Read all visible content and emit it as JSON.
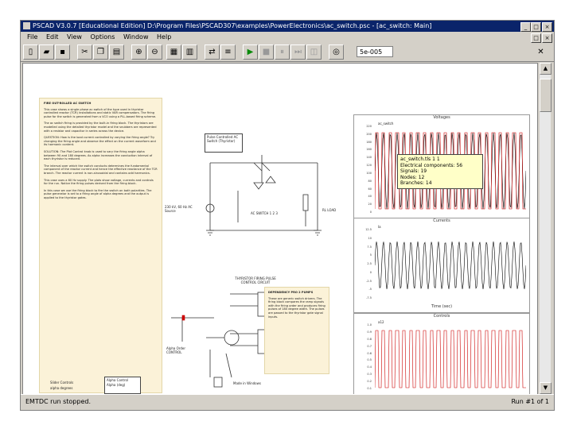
{
  "window": {
    "title": "PSCAD V3.0.7 [Educational Edition] D:\\Program Files\\PSCAD307\\examples\\PowerElectronics\\ac_switch.psc - [ac_switch: Main]"
  },
  "menu": [
    "File",
    "Edit",
    "View",
    "Options",
    "Window",
    "Help"
  ],
  "toolbar": {
    "runs_value": "5e-005"
  },
  "note_main": {
    "title": "FIRE OUT-ROLLED AC SWITCH",
    "paragraphs": [
      "This case shows a single phase ac switch of the type used in thyristor controlled reactor (TCR) installations and static VAR compensators. The firing pulse for the switch is generated from a VCO using a PLL-based firing scheme.",
      "The ac switch firing is provided by the built-in firing block. The thyristors are modelled using the detailed thyristor model and the snubbers are represented with a resistor and capacitor in series across the device.",
      "QUESTION: How is the load current controlled by varying the firing angle? Try changing the firing angle and observe the effect on the current waveform and its harmonic content.",
      "SOLUTION: The Plot Control knob is used to vary the firing angle alpha between 90 and 180 degrees. As alpha increases the conduction interval of each thyristor is reduced.",
      "The interval over which the switch conducts determines the fundamental component of the reactor current and hence the effective reactance of the TCR branch. The reactor current is non-sinusoidal and contains odd harmonics.",
      "This case uses a 60 Hz supply. The plots show voltage, currents and controls for the run. Notice the firing pulses derived from the firing block.",
      "In this case we use the firing block to fire the switch on both polarities. The pulse generator is set to a firing angle of alpha degrees and the output is applied to the thyristor gates."
    ]
  },
  "note_thyristor": {
    "text": "These are generic switch drivers. The firing block compares the ramp signals with the firing order and produces firing pulses of 180 degree width. The pulses are passed to the thyristor gate signal inputs."
  },
  "circuit_labels": {
    "pulse_controlled": "Pulse Controlled AC Switch (Thyristor)",
    "source": "230 kV, 60 Hz AC Source",
    "rectifier": "AC SWITCH 1 2 3",
    "load": "RL LOAD",
    "firing_title": "THYRISTOR FIRING PULSE CONTROL CIRCUIT",
    "dependency": "DEPENDENCY PRO 2 PUMPS",
    "alpha_control": "Alpha Control",
    "alpha_degrees": "Alpha (deg)",
    "alpha_label": "Alpha Order CONTROL",
    "slider_title": "Slider Controls",
    "slider_value": "alpha degrees",
    "bottom_note": "Made in Windows"
  },
  "plots": {
    "voltages": {
      "title": "Voltages",
      "legend": "ac_switch",
      "yticks": [
        "220",
        "200",
        "180",
        "160",
        "140",
        "120",
        "100",
        "80",
        "60",
        "40",
        "20",
        "0"
      ]
    },
    "currents": {
      "title": "Currents",
      "legend": "Ia",
      "yticks": [
        "12.5",
        "10",
        "7.5",
        "5",
        "2.5",
        "0",
        "-2.5",
        "-5",
        "-7.5"
      ],
      "xlabel": "Time (sec)"
    },
    "controls": {
      "title": "Controls",
      "legend": "a12",
      "yticks": [
        "1.0",
        "0.9",
        "0.8",
        "0.7",
        "0.6",
        "0.5",
        "0.4",
        "0.3",
        "0.2",
        "0.1"
      ]
    }
  },
  "tooltip": {
    "lines": [
      "ac_switch.tls 1 1",
      "Electrical components: 56",
      "Signals: 19",
      "Nodes: 12",
      "Branches: 14"
    ]
  },
  "status": {
    "left": "EMTDC run stopped.",
    "right": "Run #1 of 1"
  },
  "colors": {
    "title_bg": "#0a246a",
    "trace_black": "#000000",
    "trace_red": "#cc0000",
    "note_bg": "#fbf2d8"
  }
}
